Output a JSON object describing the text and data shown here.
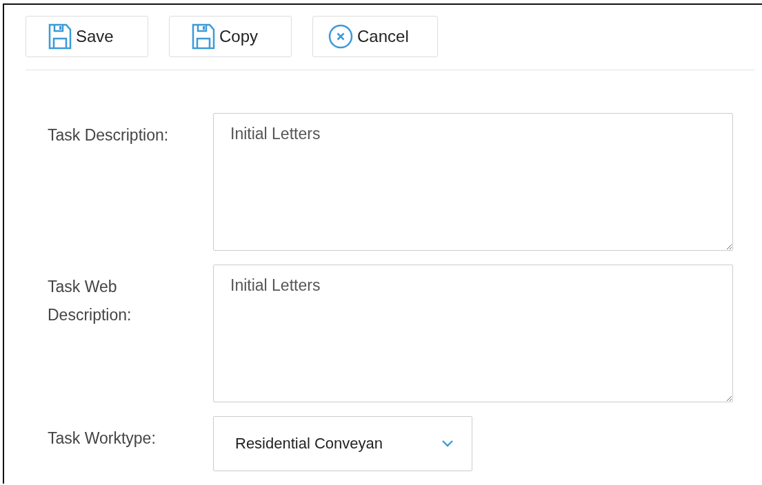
{
  "toolbar": [
    {
      "kind": "save",
      "label": "Save"
    },
    {
      "kind": "copy",
      "label": "Copy"
    },
    {
      "kind": "cancel",
      "label": "Cancel"
    }
  ],
  "fields": [
    {
      "kind": "textarea",
      "label": "Task Description:",
      "value": "Initial Letters"
    },
    {
      "kind": "textarea",
      "label": "Task Web Description:",
      "value": "Initial Letters"
    },
    {
      "kind": "dropdown",
      "label": "Task Worktype:",
      "value": "Residential Conveyan"
    }
  ]
}
